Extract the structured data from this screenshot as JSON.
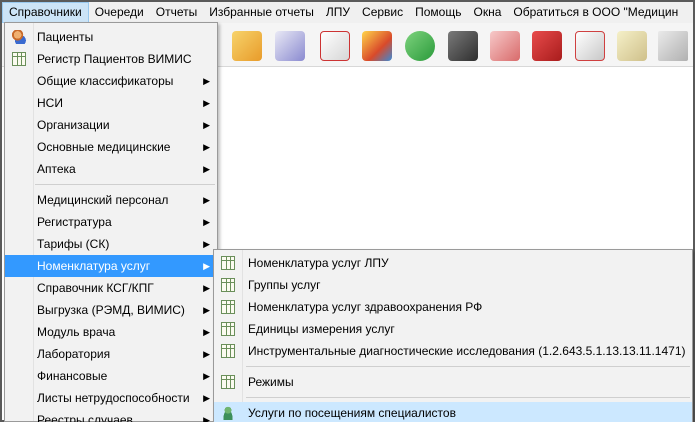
{
  "menubar": {
    "items": [
      "Справочники",
      "Очереди",
      "Отчеты",
      "Избранные отчеты",
      "ЛПУ",
      "Сервис",
      "Помощь",
      "Окна",
      "Обратиться в ООО \"Медицин"
    ]
  },
  "toolbar": {
    "icons": [
      "patient-card-icon",
      "medkit-icon",
      "doctor-icon",
      "books-icon",
      "pills-icon",
      "barcode-scanner-icon",
      "nurse-icon",
      "red-book-icon",
      "calendar-icon",
      "lock-file-icon",
      "thermometer-icon"
    ]
  },
  "main_menu": {
    "group1": [
      {
        "label": "Пациенты",
        "icon": "patients-icon"
      },
      {
        "label": "Регистр Пациентов ВИМИС",
        "icon": "table-icon"
      },
      {
        "label": "Общие классификаторы",
        "submenu": true
      },
      {
        "label": "НСИ",
        "submenu": true
      },
      {
        "label": "Организации",
        "submenu": true
      },
      {
        "label": "Основные медицинские",
        "submenu": true
      },
      {
        "label": "Аптека",
        "submenu": true
      }
    ],
    "group2": [
      {
        "label": "Медицинский персонал",
        "submenu": true
      },
      {
        "label": "Регистратура",
        "submenu": true
      },
      {
        "label": "Тарифы (СК)",
        "submenu": true
      },
      {
        "label": "Номенклатура услуг",
        "submenu": true
      },
      {
        "label": "Справочник КСГ/КПГ",
        "submenu": true
      },
      {
        "label": "Выгрузка (РЭМД, ВИМИС)",
        "submenu": true
      },
      {
        "label": "Модуль врача",
        "submenu": true
      },
      {
        "label": "Лаборатория",
        "submenu": true
      },
      {
        "label": "Финансовые",
        "submenu": true
      },
      {
        "label": "Листы нетрудоспособности",
        "submenu": true
      },
      {
        "label": "Реестры случаев",
        "submenu": true
      }
    ]
  },
  "submenu": {
    "group1": [
      "Номенклатура услуг ЛПУ",
      "Группы услуг",
      "Номенклатура услуг здравоохранения РФ",
      "Единицы измерения услуг",
      "Инструментальные диагностические исследования (1.2.643.5.1.13.13.11.1471)"
    ],
    "group2": [
      "Режимы",
      "Услуги по посещениям специалистов"
    ]
  },
  "colors": {
    "highlight": "#3399ff",
    "hover_light": "#cce8ff",
    "menu_bg": "#f2f2f2"
  }
}
